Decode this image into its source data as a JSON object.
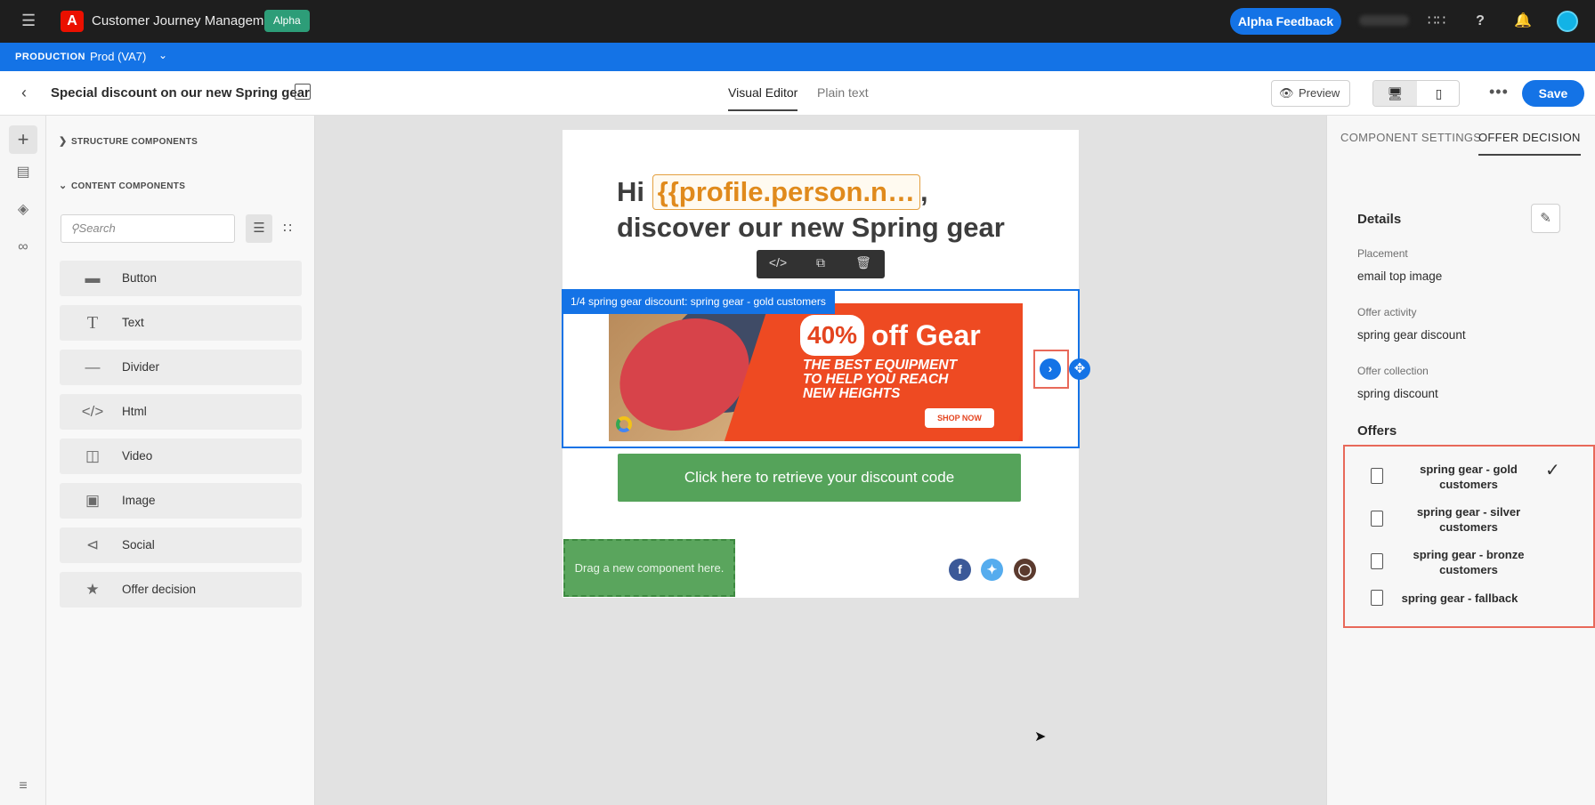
{
  "app": {
    "title": "Customer Journey Management",
    "badge": "Alpha",
    "feedback_label": "Alpha Feedback",
    "icons": [
      "menu-icon",
      "apps-grid-icon",
      "help-icon",
      "bell-icon"
    ]
  },
  "env": {
    "label": "PRODUCTION",
    "sandbox": "Prod (VA7)"
  },
  "header": {
    "title": "Special discount on our new Spring gear",
    "tabs": [
      "Visual Editor",
      "Plain text"
    ],
    "active_tab": "Visual Editor",
    "preview_label": "Preview",
    "save_label": "Save"
  },
  "components_panel": {
    "structure_label": "STRUCTURE COMPONENTS",
    "content_label": "CONTENT COMPONENTS",
    "search_placeholder": "Search",
    "items": [
      {
        "label": "Button",
        "icon": "button-icon"
      },
      {
        "label": "Text",
        "icon": "text-icon"
      },
      {
        "label": "Divider",
        "icon": "divider-icon"
      },
      {
        "label": "Html",
        "icon": "html-icon"
      },
      {
        "label": "Video",
        "icon": "video-icon"
      },
      {
        "label": "Image",
        "icon": "image-icon"
      },
      {
        "label": "Social",
        "icon": "share-icon"
      },
      {
        "label": "Offer decision",
        "icon": "offer-decision-icon"
      }
    ]
  },
  "email": {
    "greeting_prefix": "Hi",
    "token": "{{profile.person.n…",
    "greeting_suffix": ",",
    "headline_line2": "discover our new Spring gear",
    "selection_label": "1/4 spring gear discount: spring gear - gold customers",
    "banner": {
      "percent": "40%",
      "headline": "off Gear",
      "tagline": [
        "THE BEST EQUIPMENT",
        "TO HELP YOU REACH",
        "NEW HEIGHTS"
      ],
      "shop_label": "SHOP NOW"
    },
    "cta_label": "Click here to retrieve your discount code",
    "drop_label": "Drag a new component here.",
    "social": [
      "facebook-icon",
      "twitter-icon",
      "instagram-icon"
    ]
  },
  "right_panel": {
    "tabs": [
      "COMPONENT SETTINGS",
      "OFFER DECISION"
    ],
    "active_tab": "OFFER DECISION",
    "details_title": "Details",
    "placement_label": "Placement",
    "placement_value": "email top image",
    "activity_label": "Offer activity",
    "activity_value": "spring gear discount",
    "collection_label": "Offer collection",
    "collection_value": "spring discount",
    "offers_title": "Offers",
    "offers": [
      {
        "line1": "spring gear - gold",
        "line2": "customers",
        "selected": true
      },
      {
        "line1": "spring gear - silver",
        "line2": "customers",
        "selected": false
      },
      {
        "line1": "spring gear - bronze",
        "line2": "customers",
        "selected": false
      },
      {
        "line1": "spring gear - fallback",
        "line2": "",
        "selected": false
      }
    ]
  },
  "colors": {
    "accent": "#1473e6",
    "topbar": "#1e1e1e",
    "alpha_badge": "#2d9d78",
    "cta_green": "#55a35a",
    "highlight_red": "#e8695a",
    "token_orange": "#e08a1c"
  }
}
